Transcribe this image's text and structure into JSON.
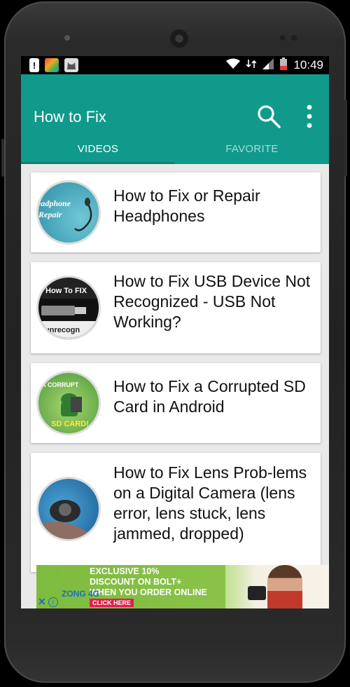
{
  "status_bar": {
    "time": "10:49",
    "left_icons": [
      "alert-icon",
      "app-icon",
      "cat-icon"
    ],
    "right_icons": [
      "wifi-icon",
      "signal-icon",
      "battery-icon"
    ]
  },
  "app_bar": {
    "title": "How to Fix",
    "color": "#109a8c",
    "actions": [
      "search-icon",
      "more-vert-icon"
    ]
  },
  "tabs": [
    {
      "label": "VIDEOS",
      "active": true
    },
    {
      "label": "FAVORITE",
      "active": false
    }
  ],
  "videos": [
    {
      "title": "How to Fix or Repair Headphones",
      "thumb_text": [
        "eadphone",
        "Repair"
      ]
    },
    {
      "title": "How to Fix USB Device Not Recognized - USB Not Working?",
      "thumb_text": [
        "How To FIX",
        "B unrecogn"
      ]
    },
    {
      "title": "How to Fix a Corrupted SD Card in Android",
      "thumb_text": [
        "X A CORRUPT",
        "SD CARD!"
      ]
    },
    {
      "title": "How to Fix Lens Prob-lems on a Digital Camera (lens error, lens stuck, lens jammed, dropped)",
      "thumb_text": []
    }
  ],
  "ad": {
    "line1": "EXCLUSIVE 10%",
    "line2": "DISCOUNT ON BOLT+",
    "line3": "WHEN YOU ORDER ONLINE",
    "cta": "CLICK HERE",
    "logo": "ZONG 4G"
  }
}
